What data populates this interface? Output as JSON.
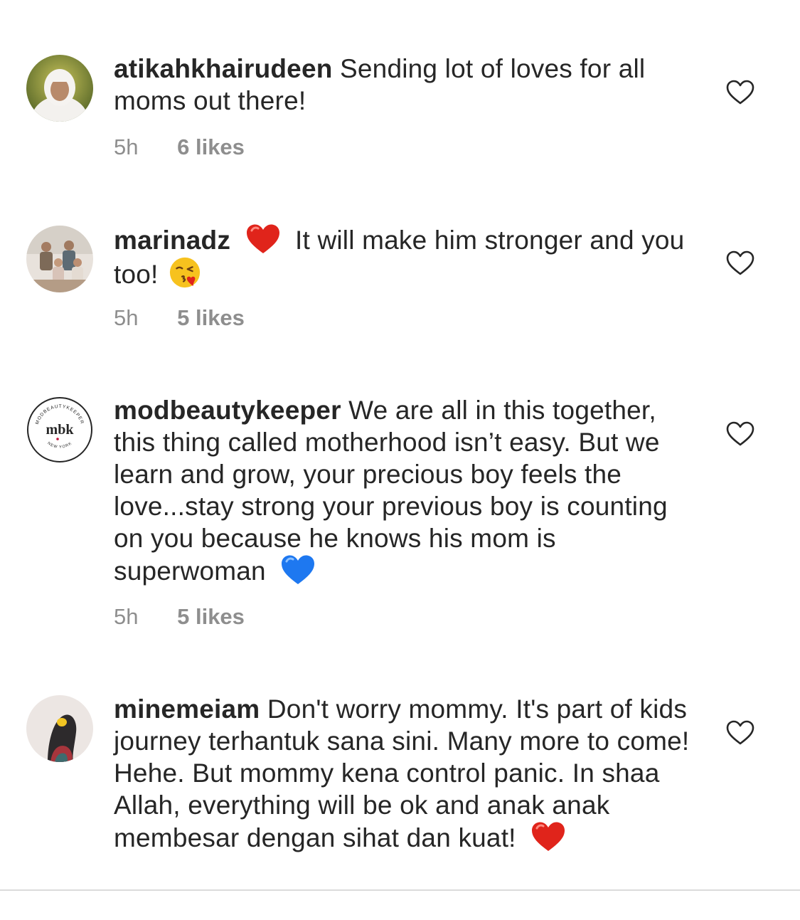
{
  "comments": [
    {
      "username": "atikahkhairudeen",
      "text_before_emoji": "Sending lot of loves for all moms out there!",
      "text_after_emoji": "",
      "time": "5h",
      "likes": "6 likes"
    },
    {
      "username": "marinadz",
      "text_before_emoji": "",
      "text_after_emoji": "It will make him stronger and you too!",
      "time": "5h",
      "likes": "5 likes"
    },
    {
      "username": "modbeautykeeper",
      "avatar_logo_text": "mbk",
      "avatar_ring_top": "MODBEAUTYKEEPER",
      "avatar_ring_bottom": "NEW YORK",
      "text_before_emoji": "We are all in this together, this thing called motherhood isn’t easy. But we learn and grow, your precious boy feels the love...stay strong your previous boy is counting on you because he knows his mom is superwoman",
      "time": "5h",
      "likes": "5 likes"
    },
    {
      "username": "minemeiam",
      "text_before_emoji": "Don't worry mommy. It's part of kids journey terhantuk sana sini. Many more to come! Hehe. But mommy kena control panic. In shaa Allah, everything will be ok and anak anak membesar dengan sihat dan kuat!"
    }
  ],
  "icons": {
    "like": "heart-outline-icon",
    "red_heart": "red-heart-emoji",
    "blue_heart": "blue-heart-emoji",
    "kiss": "face-blowing-kiss-emoji"
  },
  "colors": {
    "text": "#262626",
    "meta": "#8e8e8e",
    "red_heart": "#e0241b",
    "blue_heart": "#1e78f0"
  }
}
